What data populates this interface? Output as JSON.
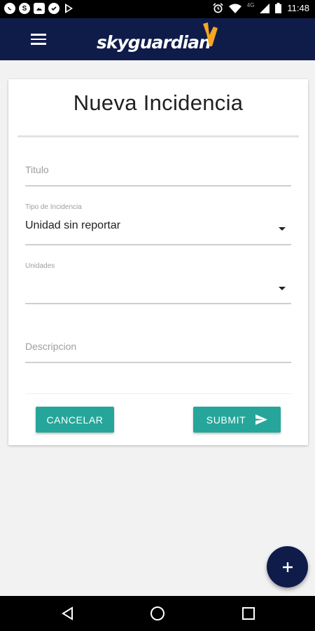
{
  "status_bar": {
    "time": "11:48",
    "network": "4G",
    "left_icons": [
      "whatsapp-icon",
      "skype-icon",
      "image-icon",
      "check-circle-icon",
      "play-store-icon"
    ],
    "right_icons": [
      "alarm-icon",
      "wifi-icon",
      "signal-icon",
      "battery-icon"
    ]
  },
  "app_bar": {
    "logo_text": "skyguardian",
    "menu_icon": "menu-icon"
  },
  "form": {
    "title": "Nueva Incidencia",
    "titulo": {
      "placeholder": "Titulo",
      "value": ""
    },
    "tipo_incidencia": {
      "label": "Tipo de Incidencia",
      "selected": "Unidad sin reportar"
    },
    "unidades": {
      "label": "Unidades",
      "selected": ""
    },
    "descripcion": {
      "placeholder": "Descripcion",
      "value": ""
    },
    "cancel_label": "CANCELAR",
    "submit_label": "SUBMIT"
  },
  "fab": {
    "icon": "plus-icon"
  },
  "nav_bar": {
    "icons": [
      "back-icon",
      "home-icon",
      "recents-icon"
    ]
  },
  "colors": {
    "app_bar": "#0f1c4a",
    "accent_button": "#26a69a",
    "fab": "#0f1c4a",
    "logo_mark": "#f5a623"
  }
}
